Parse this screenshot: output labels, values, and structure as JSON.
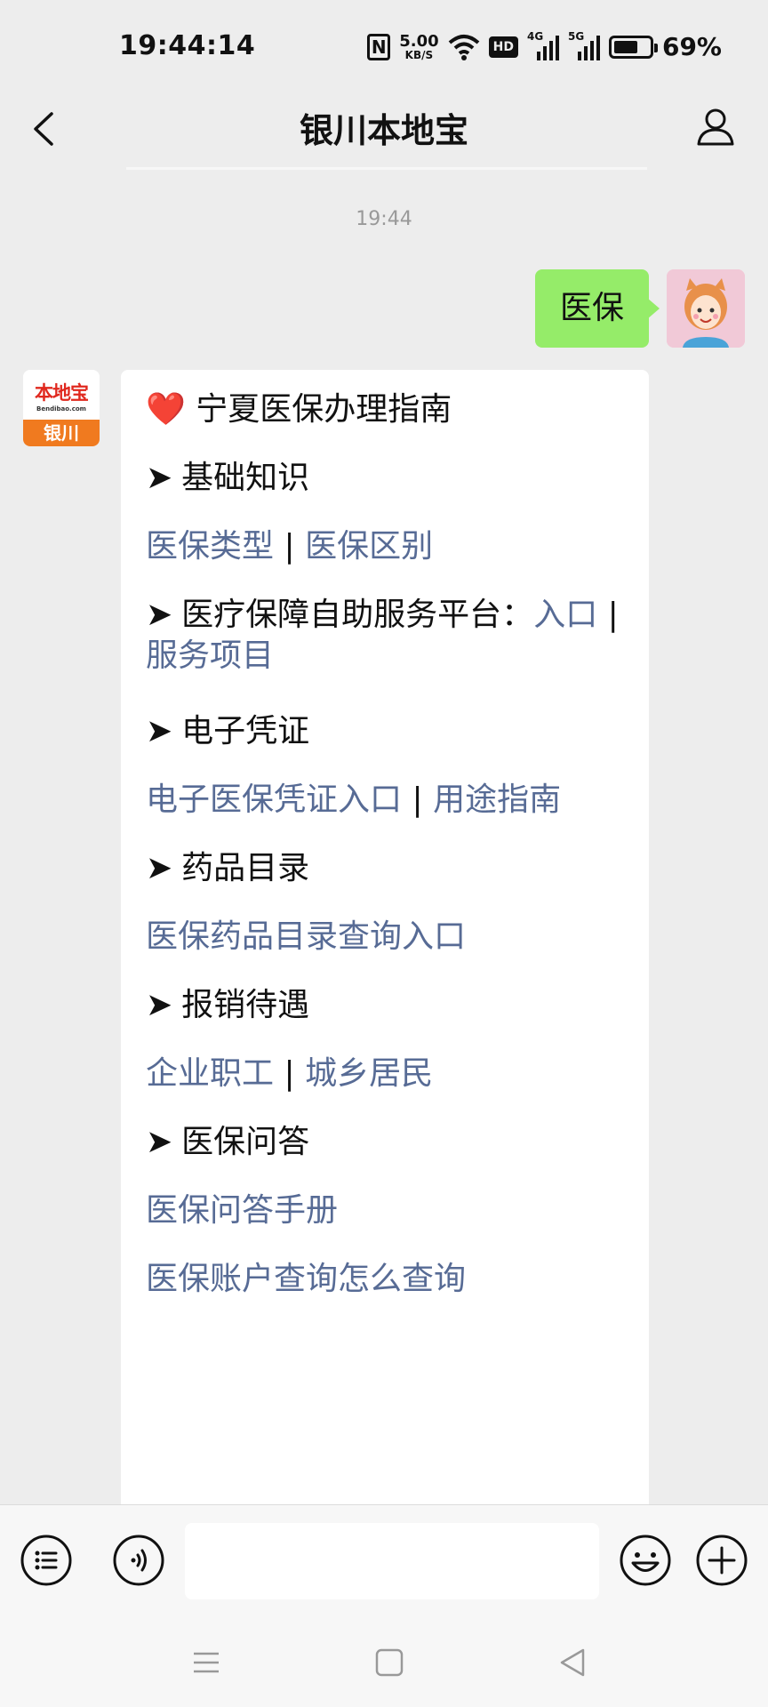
{
  "status_bar": {
    "time": "19:44:14",
    "net_speed_value": "5.00",
    "net_speed_unit": "KB/S",
    "hd_label": "HD",
    "sig1_label": "4G",
    "sig2_label": "5G",
    "battery_percent": "69%",
    "battery_level": 0.69
  },
  "nav": {
    "title": "银川本地宝"
  },
  "chat": {
    "timestamp": "19:44",
    "user_message": "医保",
    "bot_avatar": {
      "brand": "本地宝",
      "url": "Bendibao.com",
      "city": "银川"
    },
    "bot_message": {
      "heart": "❤️",
      "title": "宁夏医保办理指南",
      "arrow": "➤",
      "section_basic": "基础知识",
      "link_type": "医保类型",
      "sep": "|",
      "link_diff": "医保区别",
      "section_platform": "医疗保障自助服务平台：",
      "link_entry": "入口",
      "link_service": "服务项目",
      "section_ecert": "电子凭证",
      "link_ecert_entry": "电子医保凭证入口",
      "link_usage": "用途指南",
      "section_drugs": "药品目录",
      "link_drug_query": "医保药品目录查询入口",
      "section_reimburse": "报销待遇",
      "link_employee": "企业职工",
      "link_resident": "城乡居民",
      "section_qa": "医保问答",
      "link_qa_manual": "医保问答手册",
      "link_account_query": "医保账户查询怎么查询"
    }
  },
  "input_bar": {
    "menu_icon": "list-icon",
    "voice_icon": "voice-icon",
    "emoji_icon": "emoji-icon",
    "plus_icon": "plus-icon"
  },
  "colors": {
    "link": "#576b95",
    "user_bubble": "#95ec69",
    "background": "#ededed"
  }
}
